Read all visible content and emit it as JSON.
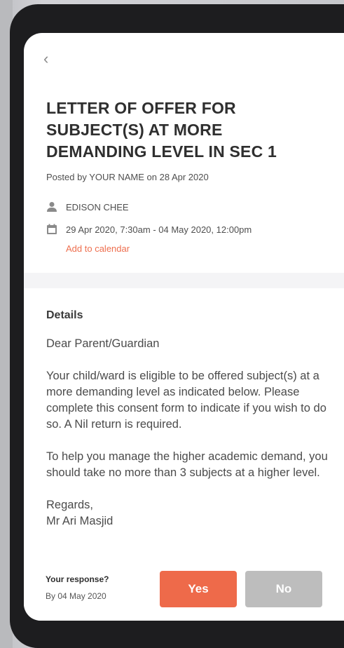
{
  "nav": {
    "back_glyph": "‹"
  },
  "header": {
    "title": "LETTER OF OFFER FOR SUBJECT(S) AT MORE DEMANDING LEVEL IN SEC 1",
    "posted_by": "Posted by YOUR NAME on 28 Apr 2020"
  },
  "meta": {
    "person": "EDISON CHEE",
    "date_range": "29 Apr 2020, 7:30am - 04 May 2020, 12:00pm",
    "add_to_calendar": "Add to calendar"
  },
  "details": {
    "heading": "Details",
    "paragraphs": [
      "Dear Parent/Guardian",
      "Your child/ward is eligible to be offered subject(s) at a more demanding level as indicated below. Please complete this consent form to indicate if you wish to do so. A Nil return is required.",
      "To help you manage the higher academic demand, you should take no more than 3 subjects at a higher level.",
      "Regards,",
      "Mr Ari Masjid"
    ]
  },
  "response": {
    "question": "Your response?",
    "deadline": "By 04 May 2020",
    "yes_label": "Yes",
    "no_label": "No"
  },
  "icons": {
    "person": "person-icon",
    "calendar": "calendar-icon"
  },
  "colors": {
    "accent": "#ee6a4a",
    "link": "#ee6f4f",
    "disabled": "#bdbdbd",
    "icon_gray": "#8a8a8a"
  }
}
